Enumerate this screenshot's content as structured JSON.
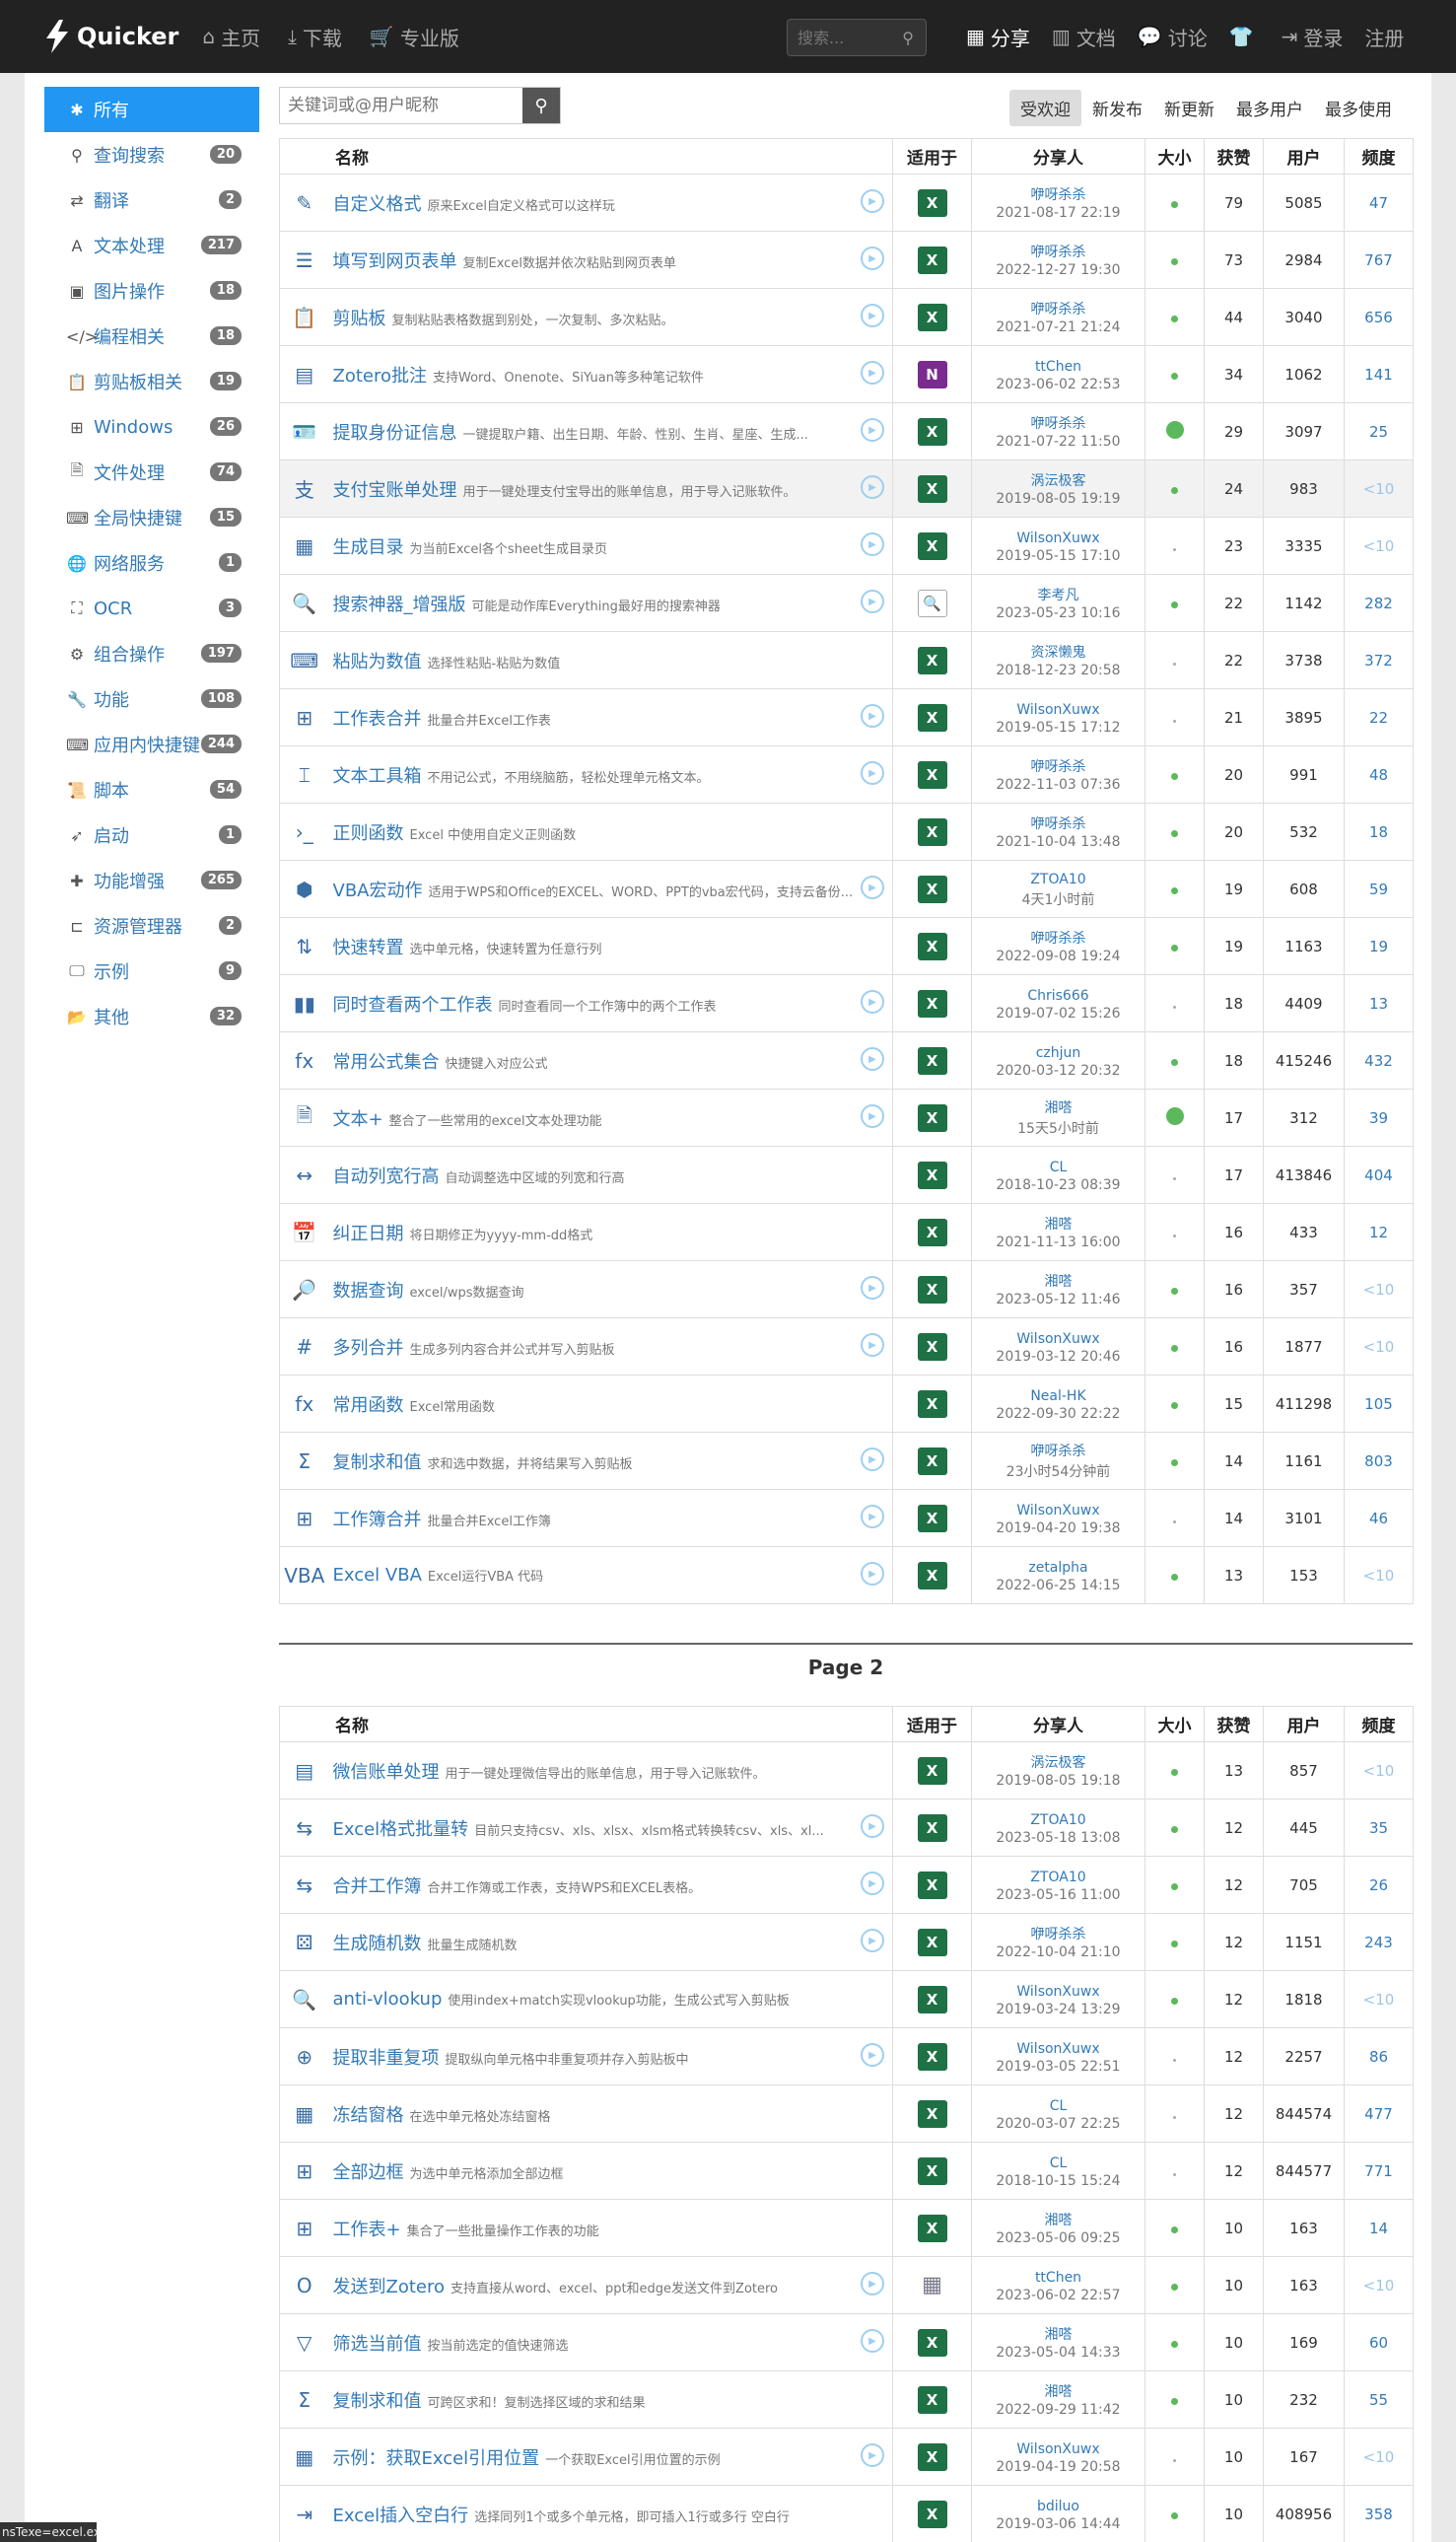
{
  "nav": {
    "brand": "Quicker",
    "links": [
      {
        "icon": "home-icon",
        "glyph": "⌂",
        "label": "主页"
      },
      {
        "icon": "download-icon",
        "glyph": "⤓",
        "label": "下载"
      },
      {
        "icon": "cart-icon",
        "glyph": "🛒",
        "label": "专业版"
      }
    ],
    "search_placeholder": "搜索...",
    "right_links": [
      {
        "icon": "grid-icon",
        "glyph": "▦",
        "label": "分享"
      },
      {
        "icon": "books-icon",
        "glyph": "▥",
        "label": "文档"
      },
      {
        "icon": "comments-icon",
        "glyph": "💬",
        "label": "讨论"
      },
      {
        "icon": "tshirt-icon",
        "glyph": "👕",
        "label": ""
      },
      {
        "icon": "login-icon",
        "glyph": "⇥",
        "label": "登录"
      },
      {
        "icon": "register-icon",
        "glyph": "",
        "label": "注册"
      }
    ]
  },
  "sidebar": [
    {
      "icon": "asterisk-icon",
      "glyph": "✱",
      "label": "所有",
      "count": ""
    },
    {
      "icon": "search-icon",
      "glyph": "⚲",
      "label": "查询搜索",
      "count": "20"
    },
    {
      "icon": "translate-icon",
      "glyph": "⇄",
      "label": "翻译",
      "count": "2"
    },
    {
      "icon": "font-icon",
      "glyph": "A",
      "label": "文本处理",
      "count": "217"
    },
    {
      "icon": "image-icon",
      "glyph": "▣",
      "label": "图片操作",
      "count": "18"
    },
    {
      "icon": "code-icon",
      "glyph": "</>",
      "label": "编程相关",
      "count": "18"
    },
    {
      "icon": "clipboard-icon",
      "glyph": "📋",
      "label": "剪贴板相关",
      "count": "19"
    },
    {
      "icon": "windows-icon",
      "glyph": "⊞",
      "label": "Windows",
      "count": "26"
    },
    {
      "icon": "file-icon",
      "glyph": "🗎",
      "label": "文件处理",
      "count": "74"
    },
    {
      "icon": "keyboard-icon",
      "glyph": "⌨",
      "label": "全局快捷键",
      "count": "15"
    },
    {
      "icon": "globe-icon",
      "glyph": "🌐",
      "label": "网络服务",
      "count": "1"
    },
    {
      "icon": "ocr-icon",
      "glyph": "⛶",
      "label": "OCR",
      "count": "3"
    },
    {
      "icon": "cogs-icon",
      "glyph": "⚙",
      "label": "组合操作",
      "count": "197"
    },
    {
      "icon": "wrench-icon",
      "glyph": "🔧",
      "label": "功能",
      "count": "108"
    },
    {
      "icon": "keyboard-icon",
      "glyph": "⌨",
      "label": "应用内快捷键",
      "count": "244"
    },
    {
      "icon": "script-icon",
      "glyph": "📜",
      "label": "脚本",
      "count": "54"
    },
    {
      "icon": "rocket-icon",
      "glyph": "➶",
      "label": "启动",
      "count": "1"
    },
    {
      "icon": "puzzle-icon",
      "glyph": "✚",
      "label": "功能增强",
      "count": "265"
    },
    {
      "icon": "folder-tree-icon",
      "glyph": "⊏",
      "label": "资源管理器",
      "count": "2"
    },
    {
      "icon": "demo-icon",
      "glyph": "🖵",
      "label": "示例",
      "count": "9"
    },
    {
      "icon": "folder-open-icon",
      "glyph": "📂",
      "label": "其他",
      "count": "32"
    }
  ],
  "content": {
    "keyword_placeholder": "关键词或@用户昵称",
    "sort_tabs": [
      "受欢迎",
      "新发布",
      "新更新",
      "最多用户",
      "最多使用"
    ],
    "headers": {
      "name": "名称",
      "app": "适用于",
      "sharer": "分享人",
      "size": "大小",
      "likes": "获赞",
      "users": "用户",
      "freq": "频度"
    },
    "page2_label": "Page 2",
    "rows1": [
      {
        "glyph": "✎",
        "name": "自定义格式",
        "desc": "原来Excel自定义格式可以这样玩",
        "app": "X",
        "sharer": "咿呀杀杀",
        "time": "2021-08-17 22:19",
        "size": "m",
        "likes": "79",
        "users": "5085",
        "freq": "47"
      },
      {
        "glyph": "☰",
        "name": "填写到网页表单",
        "desc": "复制Excel数据并依次粘贴到网页表单",
        "app": "X",
        "sharer": "咿呀杀杀",
        "time": "2022-12-27 19:30",
        "size": "m",
        "likes": "73",
        "users": "2984",
        "freq": "767"
      },
      {
        "glyph": "📋",
        "name": "剪贴板",
        "desc": "复制粘贴表格数据到别处，一次复制、多次粘贴。",
        "app": "X",
        "sharer": "咿呀杀杀",
        "time": "2021-07-21 21:24",
        "size": "m",
        "likes": "44",
        "users": "3040",
        "freq": "656"
      },
      {
        "glyph": "▤",
        "name": "Zotero批注",
        "desc": "支持Word、Onenote、SiYuan等多种笔记软件",
        "app": "N",
        "sharer": "ttChen",
        "time": "2023-06-02 22:53",
        "size": "m",
        "likes": "34",
        "users": "1062",
        "freq": "141"
      },
      {
        "glyph": "🪪",
        "name": "提取身份证信息",
        "desc": "一键提取户籍、出生日期、年龄、性别、生肖、星座、生成...",
        "app": "X",
        "sharer": "咿呀杀杀",
        "time": "2021-07-22 11:50",
        "size": "b",
        "likes": "29",
        "users": "3097",
        "freq": "25"
      },
      {
        "glyph": "支",
        "name": "支付宝账单处理",
        "desc": "用于一键处理支付宝导出的账单信息，用于导入记账软件。",
        "app": "X",
        "sharer": "涡沄极客",
        "time": "2019-08-05 19:19",
        "size": "m",
        "likes": "24",
        "users": "983",
        "freq": "<10"
      },
      {
        "glyph": "▦",
        "name": "生成目录",
        "desc": "为当前Excel各个sheet生成目录页",
        "app": "X",
        "sharer": "WilsonXuwx",
        "time": "2019-05-15 17:10",
        "size": "t",
        "likes": "23",
        "users": "3335",
        "freq": "<10"
      },
      {
        "glyph": "🔍",
        "name": "搜索神器_增强版",
        "desc": "可能是动作库Everything最好用的搜索神器",
        "app": "S",
        "sharer": "李考凡",
        "time": "2023-05-23 10:16",
        "size": "m",
        "likes": "22",
        "users": "1142",
        "freq": "282"
      },
      {
        "glyph": "⌨",
        "name": "粘贴为数值",
        "desc": "选择性粘贴-粘贴为数值",
        "app": "X",
        "sharer": "资深懒鬼",
        "time": "2018-12-23 20:58",
        "size": "t",
        "likes": "22",
        "users": "3738",
        "freq": "372"
      },
      {
        "glyph": "⊞",
        "name": "工作表合并",
        "desc": "批量合并Excel工作表",
        "app": "X",
        "sharer": "WilsonXuwx",
        "time": "2019-05-15 17:12",
        "size": "t",
        "likes": "21",
        "users": "3895",
        "freq": "22"
      },
      {
        "glyph": "⌶",
        "name": "文本工具箱",
        "desc": "不用记公式，不用绕脑筋，轻松处理单元格文本。",
        "app": "X",
        "sharer": "咿呀杀杀",
        "time": "2022-11-03 07:36",
        "size": "m",
        "likes": "20",
        "users": "991",
        "freq": "48"
      },
      {
        "glyph": "›_",
        "name": "正则函数",
        "desc": "Excel 中使用自定义正则函数",
        "app": "X",
        "sharer": "咿呀杀杀",
        "time": "2021-10-04 13:48",
        "size": "m",
        "likes": "20",
        "users": "532",
        "freq": "18"
      },
      {
        "glyph": "⬢",
        "name": "VBA宏动作",
        "desc": "适用于WPS和Office的EXCEL、WORD、PPT的vba宏代码，支持云备份...",
        "app": "X",
        "sharer": "ZTOA10",
        "time": "4天1小时前",
        "size": "m",
        "likes": "19",
        "users": "608",
        "freq": "59"
      },
      {
        "glyph": "⇅",
        "name": "快速转置",
        "desc": "选中单元格，快速转置为任意行列",
        "app": "X",
        "sharer": "咿呀杀杀",
        "time": "2022-09-08 19:24",
        "size": "m",
        "likes": "19",
        "users": "1163",
        "freq": "19"
      },
      {
        "glyph": "▮▮",
        "name": "同时查看两个工作表",
        "desc": "同时查看同一个工作簿中的两个工作表",
        "app": "X",
        "sharer": "Chris666",
        "time": "2019-07-02 15:26",
        "size": "t",
        "likes": "18",
        "users": "4409",
        "freq": "13"
      },
      {
        "glyph": "fx",
        "name": "常用公式集合",
        "desc": "快捷键入对应公式",
        "app": "X",
        "sharer": "czhjun",
        "time": "2020-03-12 20:32",
        "size": "m",
        "likes": "18",
        "users": "415246",
        "freq": "432"
      },
      {
        "glyph": "🗎",
        "name": "文本+",
        "desc": "整合了一些常用的excel文本处理功能",
        "app": "X",
        "sharer": "湘嗒",
        "time": "15天5小时前",
        "size": "b",
        "likes": "17",
        "users": "312",
        "freq": "39"
      },
      {
        "glyph": "↔",
        "name": "自动列宽行高",
        "desc": "自动调整选中区域的列宽和行高",
        "app": "X",
        "sharer": "CL",
        "time": "2018-10-23 08:39",
        "size": "t",
        "likes": "17",
        "users": "413846",
        "freq": "404"
      },
      {
        "glyph": "📅",
        "name": "纠正日期",
        "desc": "将日期修正为yyyy-mm-dd格式",
        "app": "X",
        "sharer": "湘嗒",
        "time": "2021-11-13 16:00",
        "size": "t",
        "likes": "16",
        "users": "433",
        "freq": "12"
      },
      {
        "glyph": "🔎",
        "name": "数据查询",
        "desc": "excel/wps数据查询",
        "app": "X",
        "sharer": "湘嗒",
        "time": "2023-05-12 11:46",
        "size": "m",
        "likes": "16",
        "users": "357",
        "freq": "<10"
      },
      {
        "glyph": "#",
        "name": "多列合并",
        "desc": "生成多列内容合并公式并写入剪贴板",
        "app": "X",
        "sharer": "WilsonXuwx",
        "time": "2019-03-12 20:46",
        "size": "m",
        "likes": "16",
        "users": "1877",
        "freq": "<10"
      },
      {
        "glyph": "fx",
        "name": "常用函数",
        "desc": "Excel常用函数",
        "app": "X",
        "sharer": "Neal-HK",
        "time": "2022-09-30 22:22",
        "size": "m",
        "likes": "15",
        "users": "411298",
        "freq": "105"
      },
      {
        "glyph": "Σ",
        "name": "复制求和值",
        "desc": "求和选中数据，并将结果写入剪贴板",
        "app": "X",
        "sharer": "咿呀杀杀",
        "time": "23小时54分钟前",
        "size": "m",
        "likes": "14",
        "users": "1161",
        "freq": "803"
      },
      {
        "glyph": "⊞",
        "name": "工作簿合并",
        "desc": "批量合并Excel工作簿",
        "app": "X",
        "sharer": "WilsonXuwx",
        "time": "2019-04-20 19:38",
        "size": "t",
        "likes": "14",
        "users": "3101",
        "freq": "46"
      },
      {
        "glyph": "VBA",
        "name": "Excel VBA",
        "desc": "Excel运行VBA 代码",
        "app": "X",
        "sharer": "zetalpha",
        "time": "2022-06-25 14:15",
        "size": "m",
        "likes": "13",
        "users": "153",
        "freq": "<10"
      }
    ],
    "rows2": [
      {
        "glyph": "▤",
        "name": "微信账单处理",
        "desc": "用于一键处理微信导出的账单信息，用于导入记账软件。",
        "app": "X",
        "sharer": "涡沄极客",
        "time": "2019-08-05 19:18",
        "size": "m",
        "likes": "13",
        "users": "857",
        "freq": "<10"
      },
      {
        "glyph": "⇆",
        "name": "Excel格式批量转",
        "desc": "目前只支持csv、xls、xlsx、xlsm格式转换转csv、xls、xl...",
        "app": "X",
        "sharer": "ZTOA10",
        "time": "2023-05-18 13:08",
        "size": "m",
        "likes": "12",
        "users": "445",
        "freq": "35"
      },
      {
        "glyph": "⇆",
        "name": "合并工作簿",
        "desc": "合并工作簿或工作表，支持WPS和EXCEL表格。",
        "app": "X",
        "sharer": "ZTOA10",
        "time": "2023-05-16 11:00",
        "size": "m",
        "likes": "12",
        "users": "705",
        "freq": "26"
      },
      {
        "glyph": "⚄",
        "name": "生成随机数",
        "desc": "批量生成随机数",
        "app": "X",
        "sharer": "咿呀杀杀",
        "time": "2022-10-04 21:10",
        "size": "m",
        "likes": "12",
        "users": "1151",
        "freq": "243"
      },
      {
        "glyph": "🔍",
        "name": "anti-vlookup",
        "desc": "使用index+match实现vlookup功能，生成公式写入剪贴板",
        "app": "X",
        "sharer": "WilsonXuwx",
        "time": "2019-03-24 13:29",
        "size": "m",
        "likes": "12",
        "users": "1818",
        "freq": "<10"
      },
      {
        "glyph": "⊕",
        "name": "提取非重复项",
        "desc": "提取纵向单元格中非重复项并存入剪贴板中",
        "app": "X",
        "sharer": "WilsonXuwx",
        "time": "2019-03-05 22:51",
        "size": "t",
        "likes": "12",
        "users": "2257",
        "freq": "86"
      },
      {
        "glyph": "▦",
        "name": "冻结窗格",
        "desc": "在选中单元格处冻结窗格",
        "app": "X",
        "sharer": "CL",
        "time": "2020-03-07 22:25",
        "size": "t",
        "likes": "12",
        "users": "844574",
        "freq": "477"
      },
      {
        "glyph": "⊞",
        "name": "全部边框",
        "desc": "为选中单元格添加全部边框",
        "app": "X",
        "sharer": "CL",
        "time": "2018-10-15 15:24",
        "size": "t",
        "likes": "12",
        "users": "844577",
        "freq": "771"
      },
      {
        "glyph": "⊞",
        "name": "工作表+",
        "desc": "集合了一些批量操作工作表的功能",
        "app": "X",
        "sharer": "湘嗒",
        "time": "2023-05-06 09:25",
        "size": "m",
        "likes": "10",
        "users": "163",
        "freq": "14"
      },
      {
        "glyph": "O",
        "name": "发送到Zotero",
        "desc": "支持直接从word、excel、ppt和edge发送文件到Zotero",
        "app": "G",
        "sharer": "ttChen",
        "time": "2023-06-02 22:57",
        "size": "m",
        "likes": "10",
        "users": "163",
        "freq": "<10"
      },
      {
        "glyph": "▽",
        "name": "筛选当前值",
        "desc": "按当前选定的值快速筛选",
        "app": "X",
        "sharer": "湘嗒",
        "time": "2023-05-04 14:33",
        "size": "m",
        "likes": "10",
        "users": "169",
        "freq": "60"
      },
      {
        "glyph": "Σ",
        "name": "复制求和值",
        "desc": "可跨区求和！复制选择区域的求和结果",
        "app": "X",
        "sharer": "湘嗒",
        "time": "2022-09-29 11:42",
        "size": "m",
        "likes": "10",
        "users": "232",
        "freq": "55"
      },
      {
        "glyph": "▦",
        "name": "示例：获取Excel引用位置",
        "desc": "一个获取Excel引用位置的示例",
        "app": "X",
        "sharer": "WilsonXuwx",
        "time": "2019-04-19 20:58",
        "size": "t",
        "likes": "10",
        "users": "167",
        "freq": "<10"
      },
      {
        "glyph": "⇥",
        "name": "Excel插入空白行",
        "desc": "选择同列1个或多个单元格，即可插入1行或多行 空白行",
        "app": "X",
        "sharer": "bdiluo",
        "time": "2019-03-06 14:44",
        "size": "m",
        "likes": "10",
        "users": "408956",
        "freq": "358"
      }
    ],
    "play_rows1": [
      0,
      1,
      2,
      3,
      4,
      5,
      6,
      7,
      9,
      10,
      12,
      14,
      15,
      16,
      19,
      20,
      22,
      23,
      24
    ],
    "play_rows2": [
      1,
      2,
      3,
      5,
      9,
      10,
      12
    ]
  },
  "statusbar": "nsTexe=excel.exe"
}
